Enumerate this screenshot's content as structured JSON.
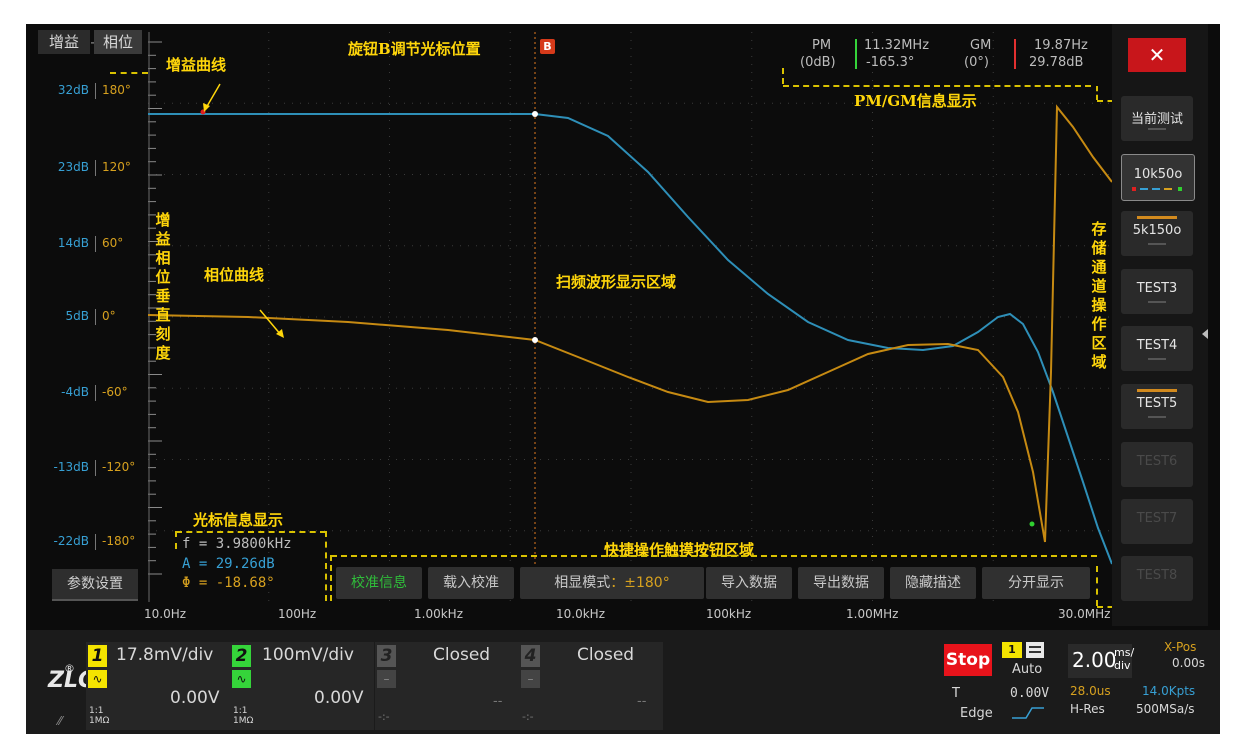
{
  "tabs": {
    "gain": "增益",
    "phase": "相位"
  },
  "left_scale": {
    "db": [
      "32dB",
      "23dB",
      "14dB",
      "5dB",
      "-4dB",
      "-13dB",
      "-22dB"
    ],
    "deg": [
      "180°",
      "120°",
      "60°",
      "0°",
      "-60°",
      "-120°",
      "-180°"
    ]
  },
  "annotations": {
    "gain_curve": "增益曲线",
    "phase_curve": "相位曲线",
    "knob_b": "旋钮B调节光标位置",
    "knob_b_badge": "B",
    "pm_gm_info": "PM/GM信息显示",
    "sweep_area": "扫频波形显示区域",
    "cursor_info": "光标信息显示",
    "shortcut_area": "快捷操作触摸按钮区域",
    "vertical_scale": [
      "增",
      "益",
      "相",
      "位",
      "垂",
      "直",
      "刻",
      "度"
    ],
    "storage_channels": [
      "存",
      "储",
      "通",
      "道",
      "操",
      "作",
      "区",
      "域"
    ]
  },
  "pm_gm": {
    "pm_label": "PM",
    "pm_sub": "(0dB)",
    "pm_freq": "11.32MHz",
    "pm_val": "-165.3°",
    "gm_label": "GM",
    "gm_sub": "(0°)",
    "gm_freq": "19.87Hz",
    "gm_val": "29.78dB"
  },
  "cursor": {
    "f": "f = 3.9800kHz",
    "a": "A = 29.26dB",
    "phi": "Φ = -18.68°"
  },
  "params_button": "参数设置",
  "buttons": {
    "calib_info": "校准信息",
    "load_calib": "载入校准",
    "phase_mode": "相显模式",
    "phase_mode_value": "：±180°",
    "import_data": "导入数据",
    "export_data": "导出数据",
    "hide_desc": "隐藏描述",
    "split_display": "分开显示"
  },
  "freq_axis": [
    "10.0Hz",
    "100Hz",
    "1.00kHz",
    "10.0kHz",
    "100kHz",
    "1.00MHz",
    "30.0MHz"
  ],
  "right_panel": {
    "close": "✕",
    "current_test": "当前测试",
    "items": [
      "10k50o",
      "5k150o",
      "TEST3",
      "TEST4",
      "TEST5",
      "TEST6",
      "TEST7",
      "TEST8"
    ]
  },
  "bottom": {
    "logo": "ZLG",
    "logo_reg": "®",
    "ch1": {
      "num": "1",
      "scale": "17.8mV/div",
      "offset": "0.00V",
      "coupling": "1:1",
      "imp": "1MΩ"
    },
    "ch2": {
      "num": "2",
      "scale": "100mV/div",
      "offset": "0.00V",
      "coupling": "1:1",
      "imp": "1MΩ"
    },
    "ch3": {
      "num": "3",
      "state": "Closed",
      "dash": "--",
      "coupling": "-:-"
    },
    "ch4": {
      "num": "4",
      "state": "Closed",
      "dash": "--",
      "coupling": "-:-"
    },
    "stop": "Stop",
    "trig_num": "1",
    "auto": "Auto",
    "t_label": "T",
    "trig_level": "0.00V",
    "edge": "Edge",
    "timebase": "2.00",
    "timebase_unit_top": "ms/",
    "timebase_unit_bot": "div",
    "xpos_label": "X-Pos",
    "xpos": "0.00s",
    "delay": "28.0us",
    "points": "14.0Kpts",
    "mode": "H-Res",
    "rate": "500MSa/s"
  },
  "colors": {
    "gain": "#2e8fb8",
    "phase": "#c68a12",
    "annotation": "#ffd60a",
    "stop": "#e8131b",
    "ch1": "#f4e400",
    "ch2": "#35d43a"
  }
}
